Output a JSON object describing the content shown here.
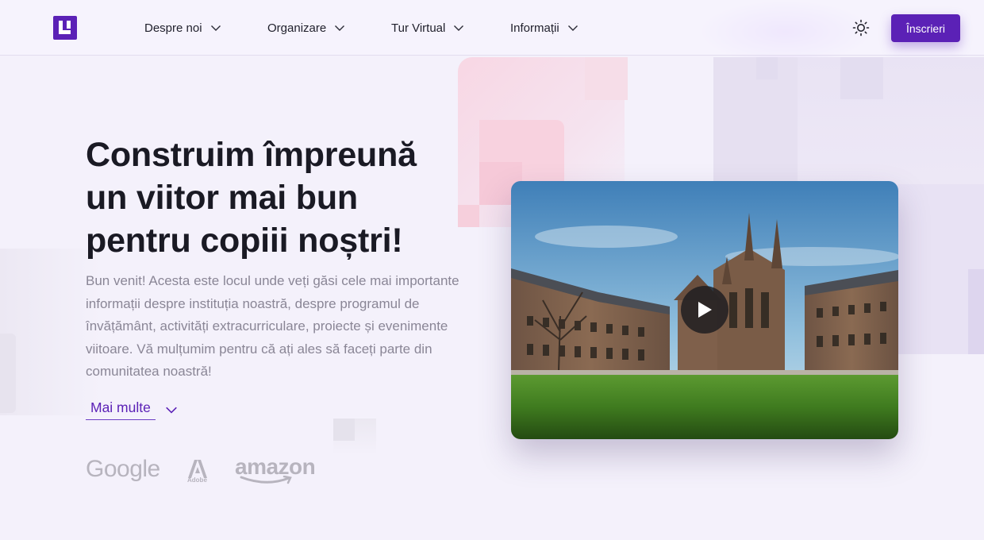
{
  "brand": {
    "logo_icon": "university-logo-icon",
    "accent": "#5b21b6"
  },
  "nav": {
    "items": [
      {
        "label": "Despre noi"
      },
      {
        "label": "Organizare"
      },
      {
        "label": "Tur Virtual"
      },
      {
        "label": "Informații"
      }
    ]
  },
  "header": {
    "theme_icon": "sun-icon",
    "cta_label": "Înscrieri"
  },
  "hero": {
    "title": "Construim împreună un viitor mai bun pentru copiii noștri!",
    "text": "Bun venit! Acesta este locul unde veți găsi cele mai importante informații despre instituția noastră, despre programul de învățământ, activități extracurriculare, proiecte și evenimente viitoare. Vă mulțumim pentru că ați ales să faceți parte din comunitatea noastră!",
    "more_label": "Mai multe"
  },
  "partners": {
    "google": "Google",
    "adobe": "Adobe",
    "amazon": "amazon"
  },
  "video": {
    "play_icon": "play-icon"
  }
}
